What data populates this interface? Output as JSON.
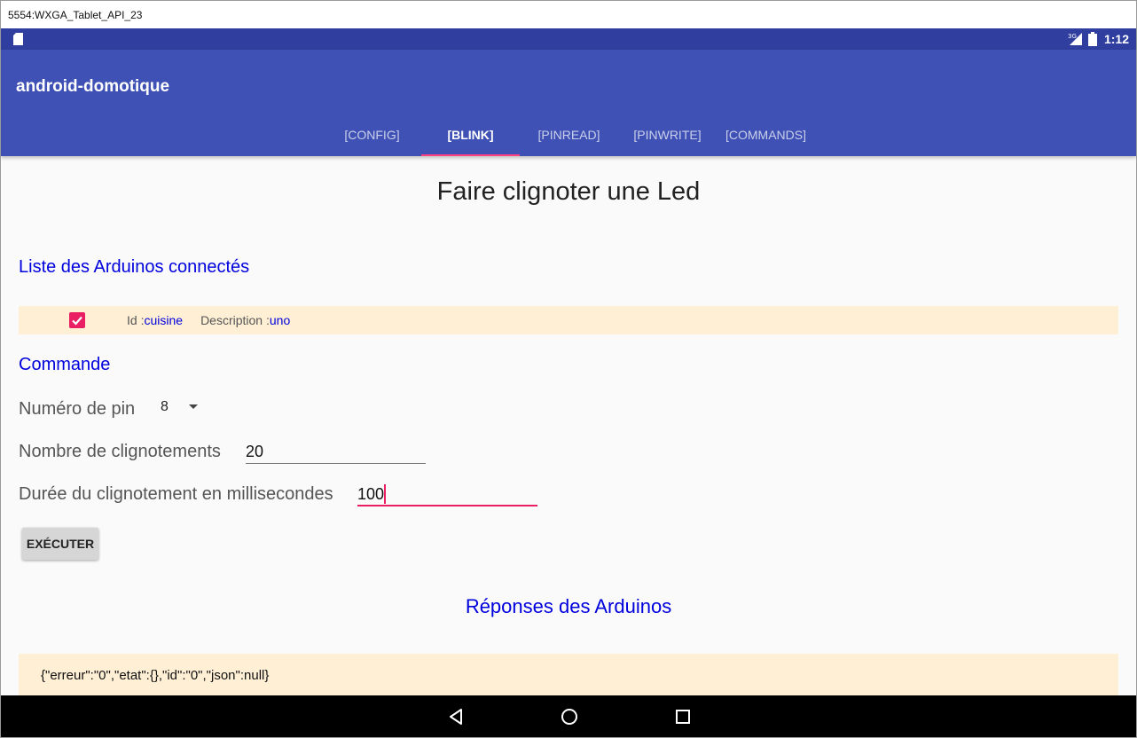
{
  "emulator": {
    "title": "5554:WXGA_Tablet_API_23"
  },
  "status_bar": {
    "time": "1:12",
    "network_label": "3G"
  },
  "app": {
    "title": "android-domotique",
    "tabs": [
      {
        "label": "[CONFIG]",
        "active": false
      },
      {
        "label": "[BLINK]",
        "active": true
      },
      {
        "label": "[PINREAD]",
        "active": false
      },
      {
        "label": "[PINWRITE]",
        "active": false
      },
      {
        "label": "[COMMANDS]",
        "active": false
      }
    ],
    "accent_color": "#ff4081",
    "primary_color": "#3f51b5"
  },
  "page": {
    "title": "Faire clignoter une Led",
    "arduino_section_title": "Liste des Arduinos connectés",
    "arduinos": [
      {
        "checked": true,
        "id_label": "Id :",
        "id_value": "cuisine",
        "description_label": "Description :",
        "description_value": "uno"
      }
    ],
    "command_section_title": "Commande",
    "pin_label": "Numéro de pin",
    "pin_value": "8",
    "count_label": "Nombre de clignotements",
    "count_value": "20",
    "duration_label": "Durée du clignotement en millisecondes",
    "duration_value": "100",
    "execute_label": "EXÉCUTER",
    "responses_title": "Réponses des Arduinos",
    "response_text": "{\"erreur\":\"0\",\"etat\":{},\"id\":\"0\",\"json\":null}"
  },
  "nav_bar": {
    "icons": [
      "back-icon",
      "home-icon",
      "recents-icon"
    ]
  }
}
